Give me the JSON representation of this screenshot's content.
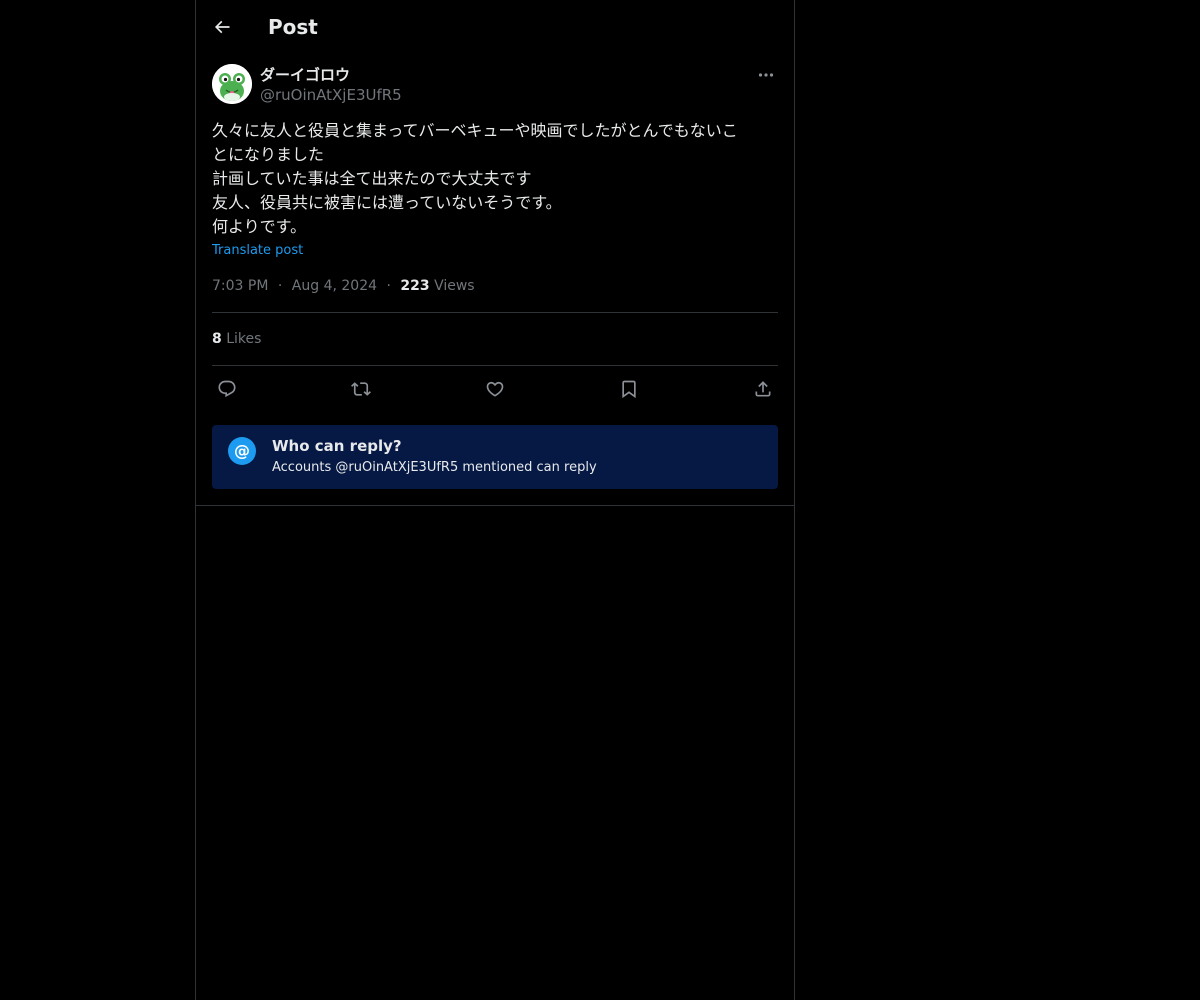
{
  "header": {
    "title": "Post",
    "back_icon": "arrow-left-icon"
  },
  "post": {
    "author": {
      "display_name": "ダーイゴロウ",
      "handle": "@ruOinAtXjE3UfR5",
      "avatar_icon": "frog-avatar"
    },
    "more_icon": "ellipsis-icon",
    "text_lines": [
      "久々に友人と役員と集まってバーベキューや映画でしたがとんでもないこ",
      "とになりました",
      "計画していた事は全て出来たので大丈夫です",
      "友人、役員共に被害には遭っていないそうです。",
      "何よりです。"
    ],
    "translate_label": "Translate post",
    "time": "7:03 PM",
    "date": "Aug 4, 2024",
    "separator": "·",
    "views_count": "223",
    "views_label": "Views",
    "likes_count": "8",
    "likes_label": "Likes"
  },
  "actions": [
    {
      "name": "reply",
      "icon": "reply-icon"
    },
    {
      "name": "repost",
      "icon": "repost-icon"
    },
    {
      "name": "like",
      "icon": "heart-icon"
    },
    {
      "name": "bookmark",
      "icon": "bookmark-icon"
    },
    {
      "name": "share",
      "icon": "share-icon"
    }
  ],
  "reply_restriction": {
    "icon_glyph": "@",
    "title": "Who can reply?",
    "subtitle": "Accounts @ruOinAtXjE3UfR5 mentioned can reply"
  },
  "colors": {
    "background": "#000000",
    "text_primary": "#e7e9ea",
    "text_secondary": "#71767b",
    "accent": "#1d9bf0",
    "reply_box_bg": "#061844",
    "border": "#2f3336"
  }
}
